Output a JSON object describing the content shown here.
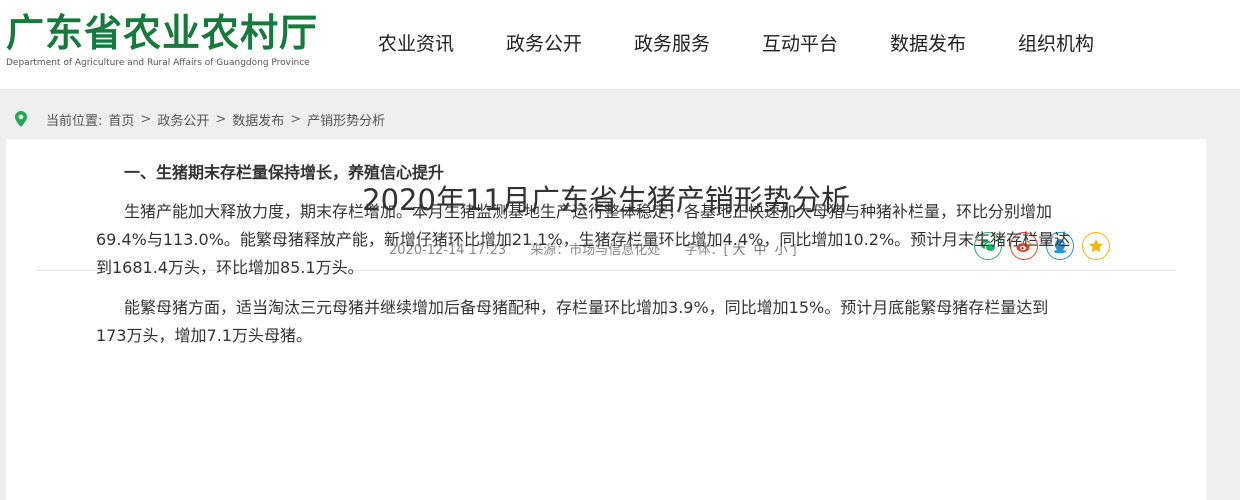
{
  "header": {
    "logo_cn": "广东省农业农村厅",
    "logo_en": "Department of Agriculture and Rural Affairs of Guangdong Province",
    "nav": [
      "农业资讯",
      "政务公开",
      "政务服务",
      "互动平台",
      "数据发布",
      "组织机构"
    ]
  },
  "breadcrumb": {
    "label": "当前位置:",
    "items": [
      "首页",
      "政务公开",
      "数据发布",
      "产销形势分析"
    ],
    "separator": ">"
  },
  "article": {
    "title": "2020年11月广东省生猪产销形势分析",
    "date": "2020-12-14 17:23",
    "source": "来源：市场与信息化处",
    "font_size_label": "字体：[",
    "font_sizes": [
      "大",
      "中",
      "小"
    ],
    "font_size_end": "]",
    "share_icons": [
      {
        "name": "wechat-icon",
        "color": "#2aae67"
      },
      {
        "name": "weibo-icon",
        "color": "#e6432a"
      },
      {
        "name": "qq-icon",
        "color": "#2a8fd6"
      },
      {
        "name": "qzone-icon",
        "color": "#f2b21a"
      }
    ],
    "heading1": "一、生猪期末存栏量保持增长，养殖信心提升",
    "paragraph1_line1": "生猪产能加大释放力度，期末存栏增加。本月生猪监测基地生产运行整体稳定，各基地正快速加大母猪与种猪补栏量，环比分别增加",
    "paragraph1_line2": "69.4%与113.0%。能繁母猪释放产能，新增仔猪环比增加21.1%，生猪存栏量环比增加4.4%，同比增加10.2%。预计月末生猪存栏量达",
    "paragraph1_line3": "到1681.4万头，环比增加85.1万头。",
    "paragraph2_line1": "能繁母猪方面，适当淘汰三元母猪并继续增加后备母猪配种，存栏量环比增加3.9%，同比增加15%。预计月底能繁母猪存栏量达到",
    "paragraph2_line2": "173万头，增加7.1万头母猪。"
  }
}
